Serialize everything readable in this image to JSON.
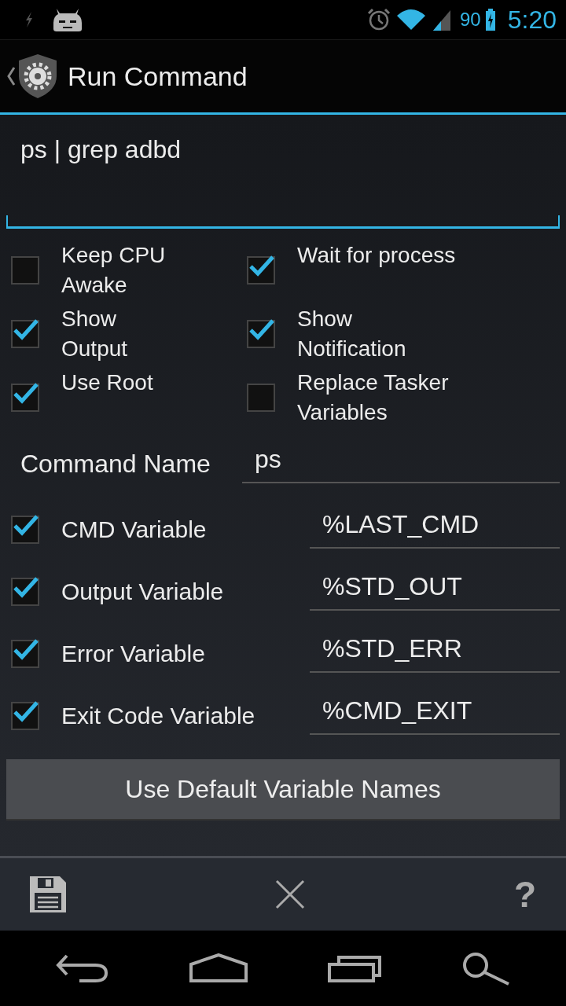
{
  "status_bar": {
    "battery": "90",
    "time": "5:20"
  },
  "action_bar": {
    "title": "Run Command"
  },
  "command": {
    "value": "ps | grep adbd"
  },
  "options": [
    {
      "label": "Keep CPU Awake",
      "checked": false
    },
    {
      "label": "Wait for process",
      "checked": true
    },
    {
      "label": "Show Output",
      "checked": true
    },
    {
      "label": "Show Notification",
      "checked": true
    },
    {
      "label": "Use Root",
      "checked": true
    },
    {
      "label": "Replace Tasker Variables",
      "checked": false
    }
  ],
  "command_name": {
    "label": "Command Name",
    "value": "ps"
  },
  "variables": [
    {
      "label": "CMD Variable",
      "checked": true,
      "value": "%LAST_CMD"
    },
    {
      "label": "Output Variable",
      "checked": true,
      "value": "%STD_OUT"
    },
    {
      "label": "Error Variable",
      "checked": true,
      "value": "%STD_ERR"
    },
    {
      "label": "Exit Code Variable",
      "checked": true,
      "value": "%CMD_EXIT"
    }
  ],
  "default_button": "Use Default Variable Names",
  "toolbar": {
    "help": "?"
  }
}
